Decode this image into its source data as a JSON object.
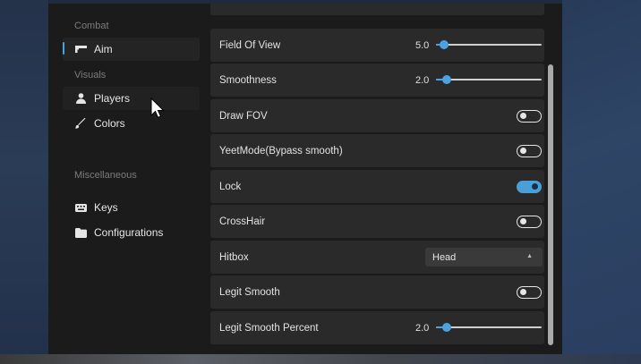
{
  "sidebar": {
    "sections": {
      "combat": "Combat",
      "visuals": "Visuals",
      "misc": "Miscellaneous"
    },
    "items": {
      "aim": {
        "label": "Aim",
        "icon": "gun-icon",
        "active": true
      },
      "players": {
        "label": "Players",
        "icon": "person-icon"
      },
      "colors": {
        "label": "Colors",
        "icon": "brush-icon"
      },
      "keys": {
        "label": "Keys",
        "icon": "keyboard-icon"
      },
      "configs": {
        "label": "Configurations",
        "icon": "folder-icon"
      }
    }
  },
  "settings": {
    "fov": {
      "label": "Field Of View",
      "value": "5.0",
      "fraction": 0.08
    },
    "smoothness": {
      "label": "Smoothness",
      "value": "2.0",
      "fraction": 0.1
    },
    "draw_fov": {
      "label": "Draw FOV",
      "on": false
    },
    "yeetmode": {
      "label": "YeetMode(Bypass smooth)",
      "on": false
    },
    "lock": {
      "label": "Lock",
      "on": true
    },
    "crosshair": {
      "label": "CrossHair",
      "on": false
    },
    "hitbox": {
      "label": "Hitbox",
      "selected": "Head"
    },
    "legit_smooth": {
      "label": "Legit Smooth",
      "on": false
    },
    "legit_smooth_percent": {
      "label": "Legit Smooth Percent",
      "value": "2.0",
      "fraction": 0.1
    }
  },
  "colors": {
    "accent": "#4aa3df",
    "panel": "#2a2a2a",
    "background": "#1b1b1b"
  }
}
